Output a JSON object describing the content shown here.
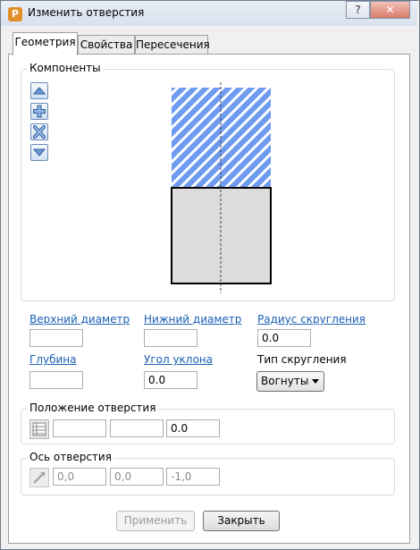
{
  "window": {
    "title": "Изменить отверстия",
    "app_icon_letter": "P"
  },
  "titlebar_buttons": {
    "help": "?",
    "close": "✕"
  },
  "tabs": [
    "Геометрия",
    "Свойства",
    "Пересечения"
  ],
  "components": {
    "label": "Компоненты"
  },
  "fields": {
    "top_diameter": {
      "label": "Верхний диаметр",
      "value": ""
    },
    "bottom_diameter": {
      "label": "Нижний диаметр",
      "value": ""
    },
    "fillet_radius": {
      "label": "Радиус скругления",
      "value": "0.0"
    },
    "depth": {
      "label": "Глубина",
      "value": ""
    },
    "draft_angle": {
      "label": "Угол уклона",
      "value": "0.0"
    },
    "fillet_type": {
      "label": "Тип скругления",
      "value": "Вогнутый"
    }
  },
  "position": {
    "label": "Положение отверстия",
    "values": [
      "",
      "",
      "0.0"
    ]
  },
  "axis": {
    "label": "Ось отверстия",
    "values": [
      "0,0",
      "0,0",
      "-1,0"
    ]
  },
  "buttons": {
    "apply": "Применить",
    "close": "Закрыть"
  },
  "colors": {
    "hatch_fill": "#6e9bf0",
    "hatch_lines": "#ffffff",
    "body_fill": "#dcdcdc",
    "link": "#1a5fb4"
  }
}
